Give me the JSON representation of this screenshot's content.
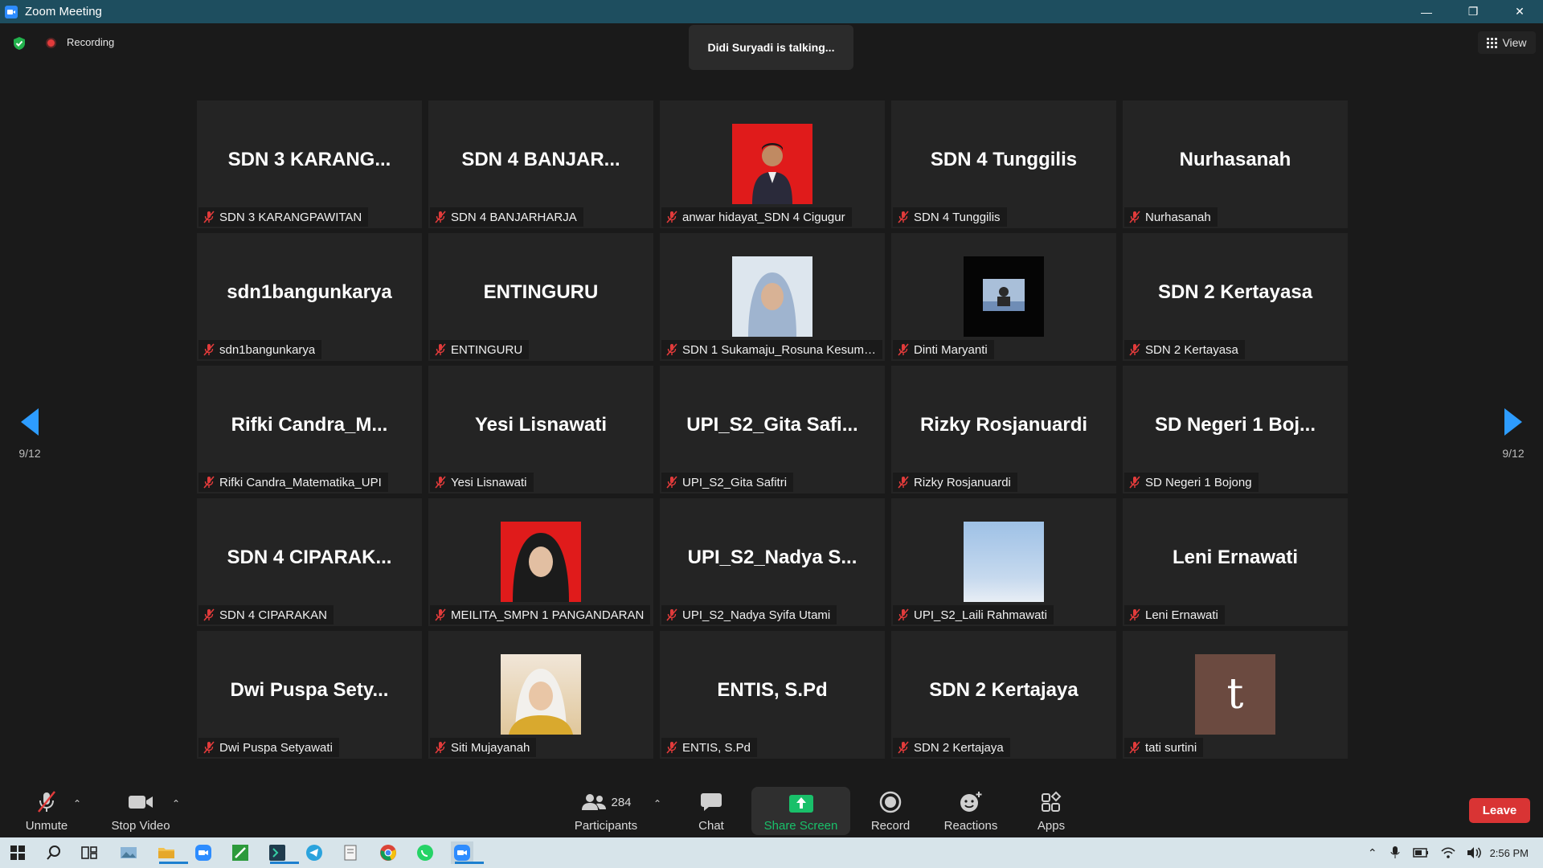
{
  "window": {
    "title": "Zoom Meeting"
  },
  "status": {
    "recording_label": "Recording",
    "talking": "Didi Suryadi is talking...",
    "view_label": "View"
  },
  "pagination": {
    "left_label": "9/12",
    "right_label": "9/12"
  },
  "tiles": [
    {
      "big": "SDN 3 KARANG...",
      "label": "SDN 3 KARANGPAWITAN",
      "photo": ""
    },
    {
      "big": "SDN 4 BANJAR...",
      "label": "SDN 4 BANJARHARJA",
      "photo": ""
    },
    {
      "big": "",
      "label": "anwar hidayat_SDN 4 Cigugur",
      "photo": "red-portrait"
    },
    {
      "big": "SDN 4 Tunggilis",
      "label": "SDN 4 Tunggilis",
      "photo": ""
    },
    {
      "big": "Nurhasanah",
      "label": "Nurhasanah",
      "photo": ""
    },
    {
      "big": "sdn1bangunkarya",
      "label": "sdn1bangunkarya",
      "photo": ""
    },
    {
      "big": "ENTINGURU",
      "label": "ENTINGURU",
      "photo": ""
    },
    {
      "big": "",
      "label": "SDN 1 Sukamaju_Rosuna Kesuma...",
      "photo": "hijab-portrait"
    },
    {
      "big": "",
      "label": "Dinti Maryanti",
      "photo": "dark-screen"
    },
    {
      "big": "SDN 2 Kertayasa",
      "label": "SDN 2 Kertayasa",
      "photo": ""
    },
    {
      "big": "Rifki Candra_M...",
      "label": "Rifki Candra_Matematika_UPI",
      "photo": ""
    },
    {
      "big": "Yesi Lisnawati",
      "label": "Yesi Lisnawati",
      "photo": ""
    },
    {
      "big": "UPI_S2_Gita Safi...",
      "label": "UPI_S2_Gita Safitri",
      "photo": ""
    },
    {
      "big": "Rizky Rosjanuardi",
      "label": "Rizky Rosjanuardi",
      "photo": ""
    },
    {
      "big": "SD Negeri 1 Boj...",
      "label": "SD Negeri 1 Bojong",
      "photo": ""
    },
    {
      "big": "SDN 4 CIPARAK...",
      "label": "SDN 4 CIPARAKAN",
      "photo": ""
    },
    {
      "big": "",
      "label": "MEILITA_SMPN 1 PANGANDARAN",
      "photo": "red-hijab-portrait"
    },
    {
      "big": "UPI_S2_Nadya S...",
      "label": "UPI_S2_Nadya Syifa Utami",
      "photo": ""
    },
    {
      "big": "",
      "label": "UPI_S2_Laili Rahmawati",
      "photo": "sky"
    },
    {
      "big": "Leni Ernawati",
      "label": "Leni Ernawati",
      "photo": ""
    },
    {
      "big": "Dwi Puspa Sety...",
      "label": "Dwi Puspa Setyawati",
      "photo": ""
    },
    {
      "big": "",
      "label": "Siti Mujayanah",
      "photo": "warm-portrait"
    },
    {
      "big": "ENTIS, S.Pd",
      "label": "ENTIS, S.Pd",
      "photo": ""
    },
    {
      "big": "SDN 2 Kertajaya",
      "label": "SDN 2 Kertajaya",
      "photo": ""
    },
    {
      "big": "",
      "label": "tati surtini",
      "photo": "letter",
      "letter": "t"
    }
  ],
  "toolbar": {
    "unmute": "Unmute",
    "stop_video": "Stop Video",
    "participants": "Participants",
    "participants_count": "284",
    "chat": "Chat",
    "share_screen": "Share Screen",
    "record": "Record",
    "reactions": "Reactions",
    "apps": "Apps",
    "leave": "Leave"
  },
  "taskbar": {
    "clock": "2:56 PM"
  },
  "colors": {
    "accent": "#2d9cff",
    "share": "#19c06a",
    "leave": "#d93434",
    "titlebar": "#1e4e5f"
  }
}
